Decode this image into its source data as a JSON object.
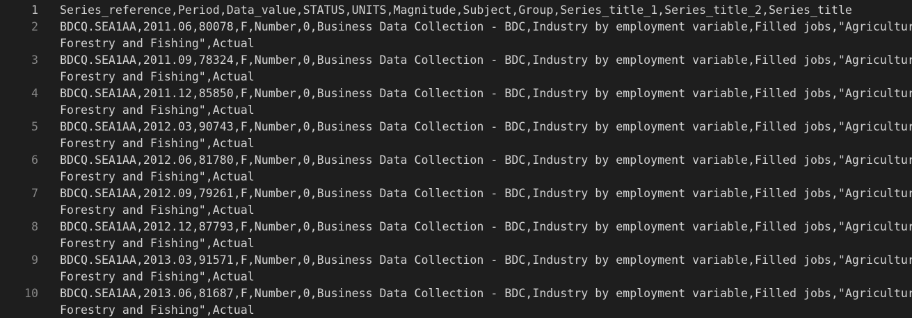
{
  "editor": {
    "lines": [
      {
        "number": "1",
        "segments": [
          "Series_reference,Period,Data_value,STATUS,UNITS,Magnitude,Subject,Group,Series_title_1,Series_title_2,Series_title"
        ]
      },
      {
        "number": "2",
        "segments": [
          "BDCQ.SEA1AA,2011.06,80078,F,Number,0,Business Data Collection - BDC,Industry by employment variable,Filled jobs,\"Agriculture,",
          "Forestry and Fishing\",Actual"
        ]
      },
      {
        "number": "3",
        "segments": [
          "BDCQ.SEA1AA,2011.09,78324,F,Number,0,Business Data Collection - BDC,Industry by employment variable,Filled jobs,\"Agriculture,",
          "Forestry and Fishing\",Actual"
        ]
      },
      {
        "number": "4",
        "segments": [
          "BDCQ.SEA1AA,2011.12,85850,F,Number,0,Business Data Collection - BDC,Industry by employment variable,Filled jobs,\"Agriculture,",
          "Forestry and Fishing\",Actual"
        ]
      },
      {
        "number": "5",
        "segments": [
          "BDCQ.SEA1AA,2012.03,90743,F,Number,0,Business Data Collection - BDC,Industry by employment variable,Filled jobs,\"Agriculture,",
          "Forestry and Fishing\",Actual"
        ]
      },
      {
        "number": "6",
        "segments": [
          "BDCQ.SEA1AA,2012.06,81780,F,Number,0,Business Data Collection - BDC,Industry by employment variable,Filled jobs,\"Agriculture,",
          "Forestry and Fishing\",Actual"
        ]
      },
      {
        "number": "7",
        "segments": [
          "BDCQ.SEA1AA,2012.09,79261,F,Number,0,Business Data Collection - BDC,Industry by employment variable,Filled jobs,\"Agriculture,",
          "Forestry and Fishing\",Actual"
        ]
      },
      {
        "number": "8",
        "segments": [
          "BDCQ.SEA1AA,2012.12,87793,F,Number,0,Business Data Collection - BDC,Industry by employment variable,Filled jobs,\"Agriculture,",
          "Forestry and Fishing\",Actual"
        ]
      },
      {
        "number": "9",
        "segments": [
          "BDCQ.SEA1AA,2013.03,91571,F,Number,0,Business Data Collection - BDC,Industry by employment variable,Filled jobs,\"Agriculture,",
          "Forestry and Fishing\",Actual"
        ]
      },
      {
        "number": "10",
        "segments": [
          "BDCQ.SEA1AA,2013.06,81687,F,Number,0,Business Data Collection - BDC,Industry by employment variable,Filled jobs,\"Agriculture,",
          "Forestry and Fishing\",Actual"
        ]
      }
    ]
  },
  "colors": {
    "background": "#1e1e1e",
    "text": "#d4d4d4",
    "line_number": "#858585",
    "active_line_number": "#c6c6c6"
  }
}
